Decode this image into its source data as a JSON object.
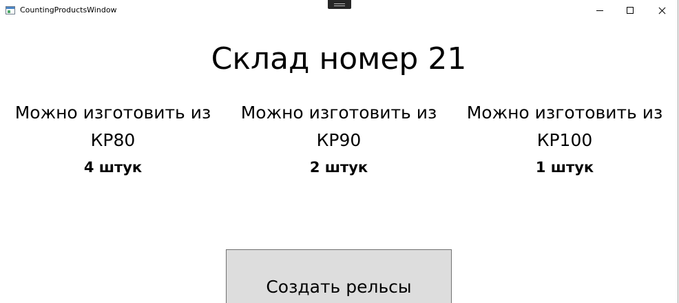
{
  "window": {
    "title": "CountingProductsWindow",
    "icons": {
      "app": "window-app-icon",
      "minimize": "minimize-icon",
      "maximize": "maximize-icon",
      "close": "close-icon"
    }
  },
  "main": {
    "heading": "Склад номер 21",
    "products": [
      {
        "line1": "Можно изготовить из",
        "line2": "КР80",
        "count": "4 штук"
      },
      {
        "line1": "Можно изготовить из",
        "line2": "КР90",
        "count": "2 штук"
      },
      {
        "line1": "Можно изготовить из",
        "line2": "КР100",
        "count": "1 штук"
      }
    ],
    "create_button_label": "Создать рельсы"
  },
  "colors": {
    "background": "#ffffff",
    "button_background": "#dddddd",
    "button_border": "#707070",
    "text": "#000000"
  }
}
